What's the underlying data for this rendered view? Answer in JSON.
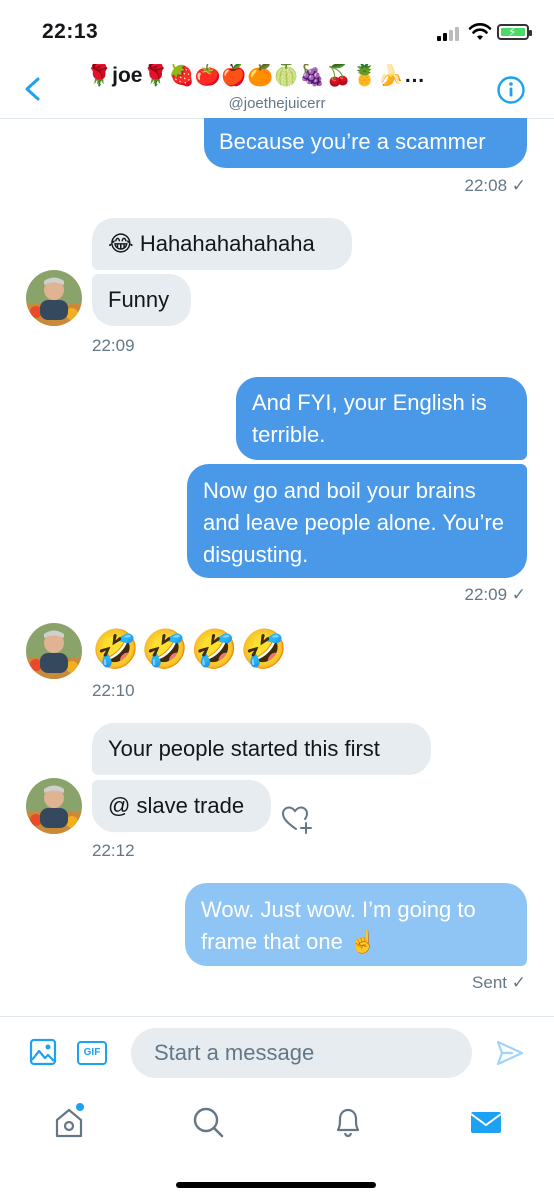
{
  "status_bar": {
    "time": "22:13"
  },
  "header": {
    "title": "🌹joe🌹🍓🍅🍎🍊🍈🍇🍒🍍🍌…",
    "handle": "@joethejuicerr"
  },
  "messages": [
    {
      "dir": "out",
      "text": "Because you’re a scammer"
    },
    {
      "dir": "meta_out",
      "text": "22:08 ✓"
    },
    {
      "dir": "in",
      "text": "😂 Hahahahahahaha"
    },
    {
      "dir": "in",
      "text": "Funny"
    },
    {
      "dir": "meta_in",
      "text": "22:09"
    },
    {
      "dir": "out",
      "text": "And FYI, your English is terrible."
    },
    {
      "dir": "out",
      "text": "Now go and boil your brains and leave people alone. You’re disgusting."
    },
    {
      "dir": "meta_out",
      "text": "22:09 ✓"
    },
    {
      "dir": "in_emoji",
      "text": "🤣🤣🤣🤣"
    },
    {
      "dir": "meta_in",
      "text": "22:10"
    },
    {
      "dir": "in",
      "text": "Your people started this first"
    },
    {
      "dir": "in",
      "text": "@ slave trade"
    },
    {
      "dir": "meta_in",
      "text": "22:12"
    },
    {
      "dir": "out_pending",
      "text": "Wow. Just wow. I’m going to frame that one ☝️"
    },
    {
      "dir": "meta_out",
      "text": "Sent ✓"
    }
  ],
  "composer": {
    "placeholder": "Start a message",
    "gif_label": "GIF"
  },
  "colors": {
    "accent": "#1da1f2",
    "bubble_out": "#4a99e9",
    "bubble_pending": "#8ec5f5",
    "bubble_in": "#e6ecf0"
  },
  "icons": [
    "back-chevron-icon",
    "info-icon",
    "media-icon",
    "gif-icon",
    "send-icon",
    "home-icon",
    "search-icon",
    "bell-icon",
    "mail-icon",
    "like-add-icon"
  ]
}
